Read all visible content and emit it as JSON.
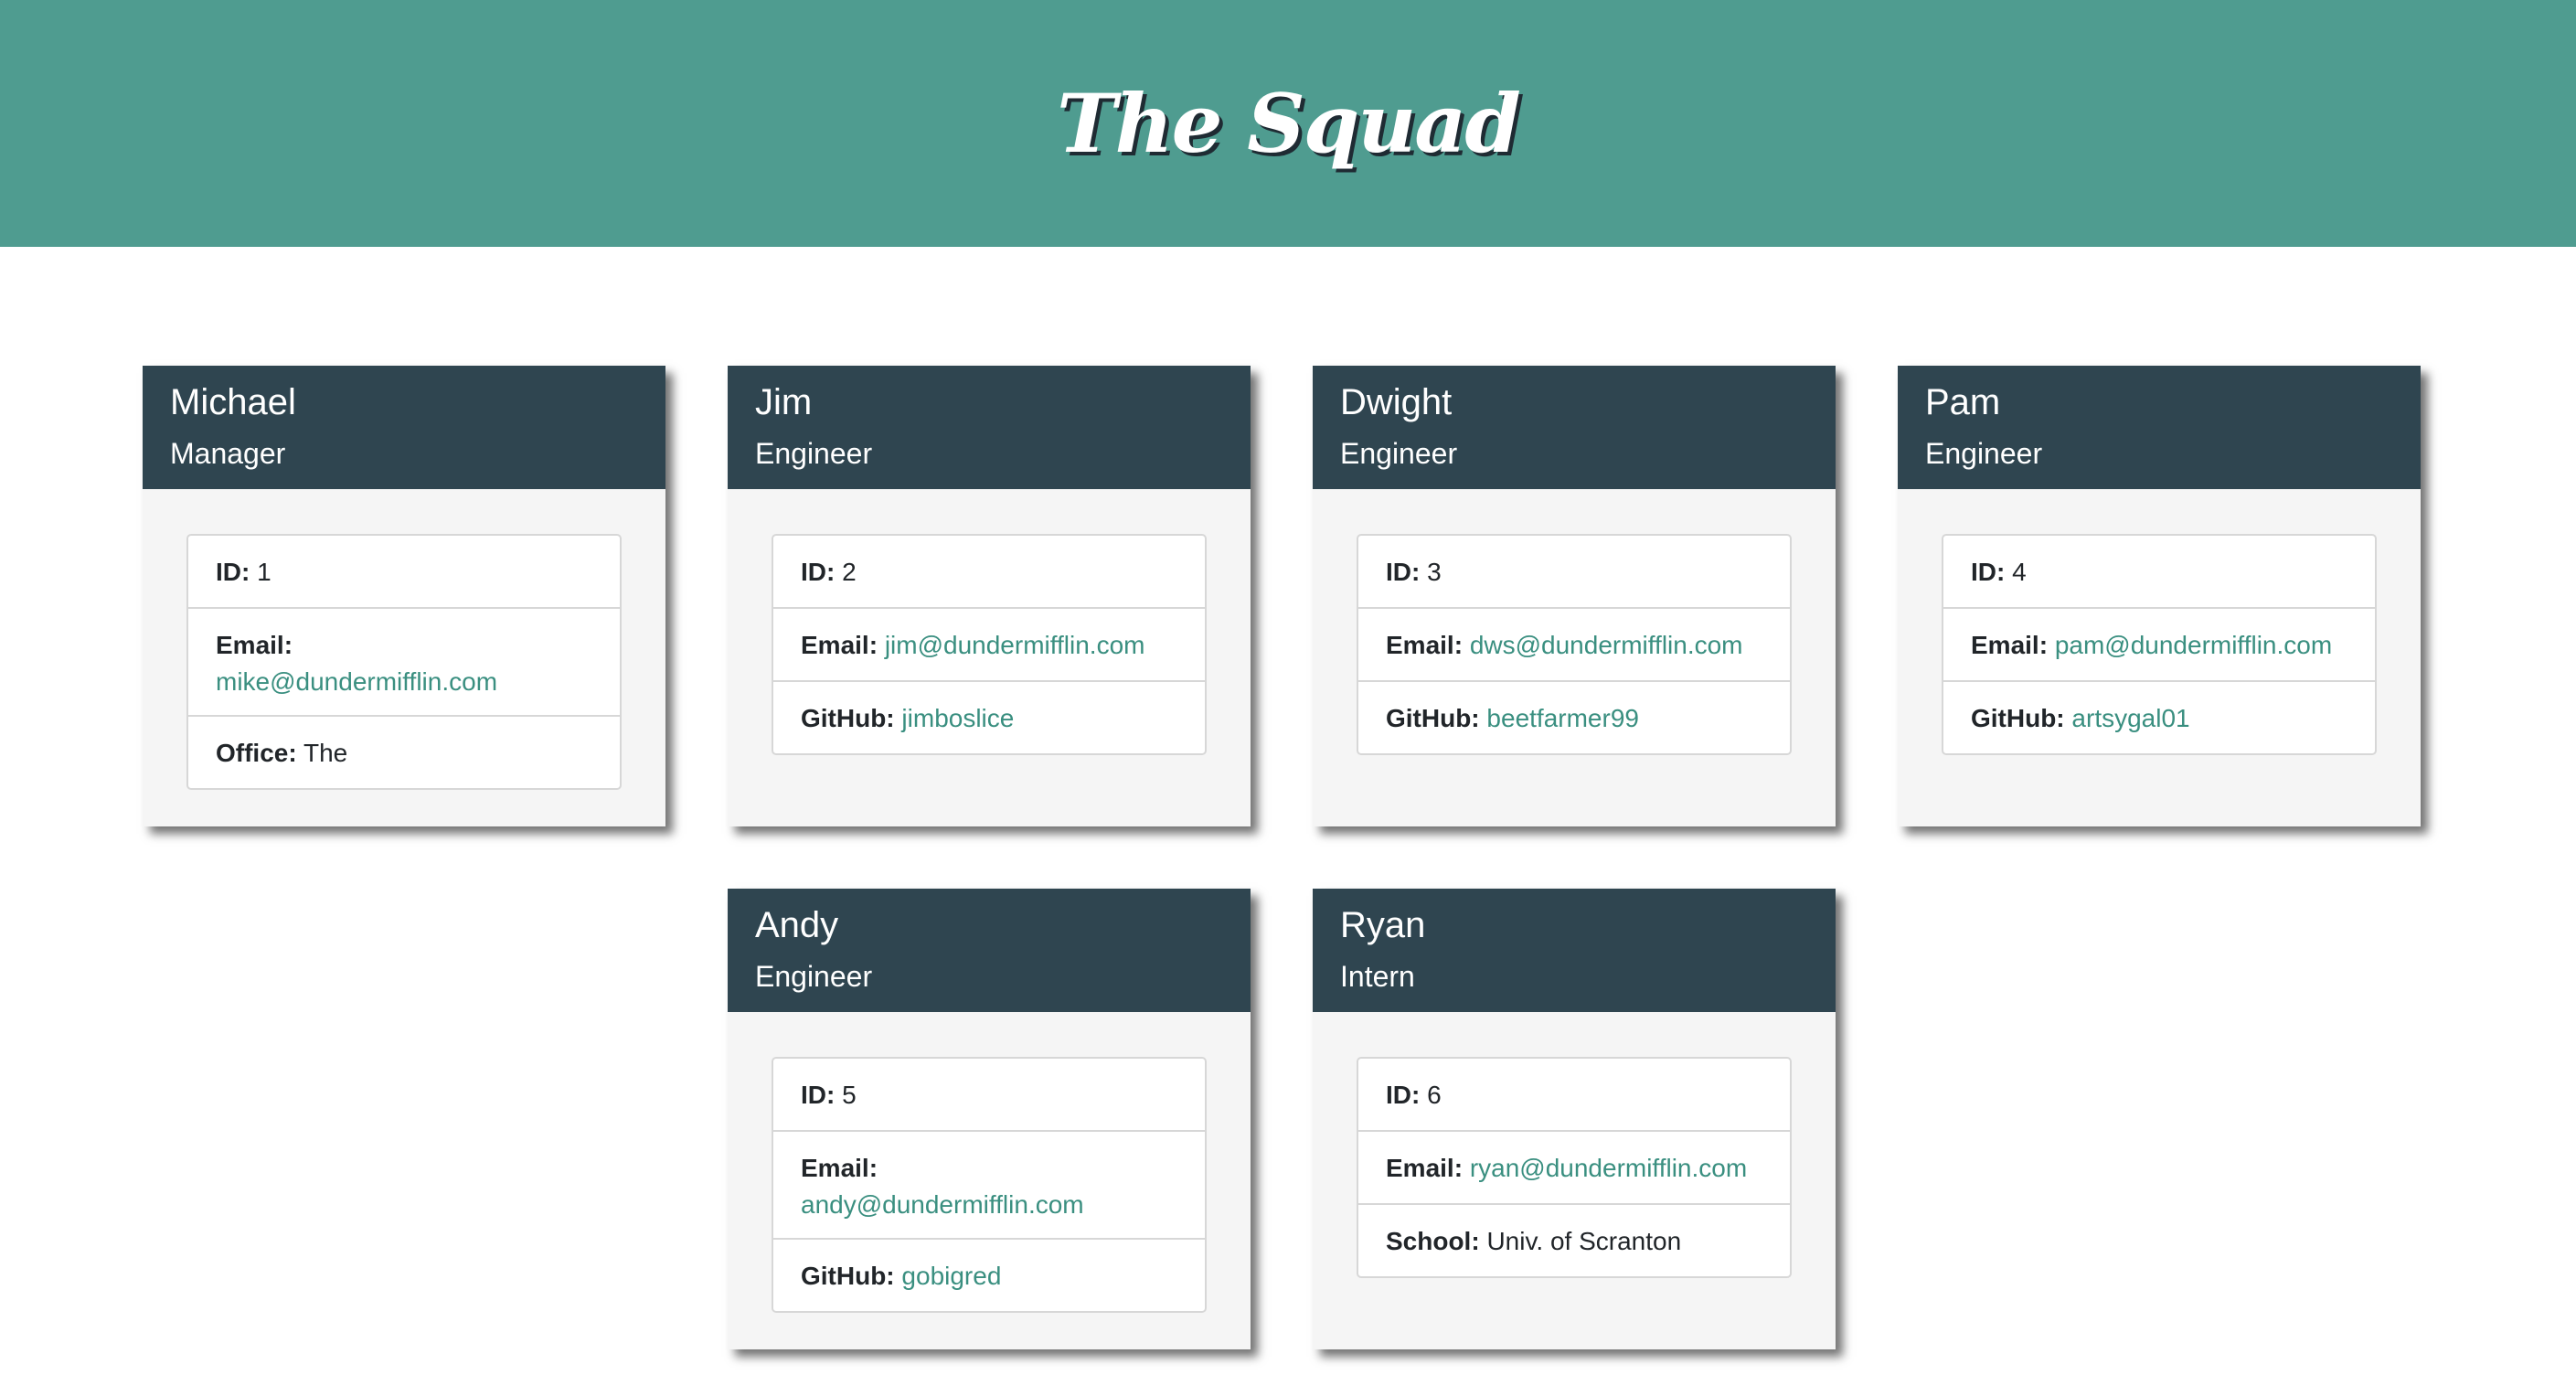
{
  "header": {
    "title": "The Squad"
  },
  "labels": {
    "id": "ID:",
    "email": "Email:",
    "github": "GitHub:",
    "office": "Office:",
    "school": "School:"
  },
  "team": [
    {
      "name": "Michael",
      "role": "Manager",
      "id": "1",
      "email": "mike@dundermifflin.com",
      "office": "The"
    },
    {
      "name": "Jim",
      "role": "Engineer",
      "id": "2",
      "email": "jim@dundermifflin.com",
      "github": "jimboslice"
    },
    {
      "name": "Dwight",
      "role": "Engineer",
      "id": "3",
      "email": "dws@dundermifflin.com",
      "github": "beetfarmer99"
    },
    {
      "name": "Pam",
      "role": "Engineer",
      "id": "4",
      "email": "pam@dundermifflin.com",
      "github": "artsygal01"
    },
    {
      "name": "Andy",
      "role": "Engineer",
      "id": "5",
      "email": "andy@dundermifflin.com",
      "github": "gobigred"
    },
    {
      "name": "Ryan",
      "role": "Intern",
      "id": "6",
      "email": "ryan@dundermifflin.com",
      "school": "Univ. of Scranton"
    }
  ],
  "colors": {
    "header_bg": "#4f9c90",
    "card_header_bg": "#2f4550",
    "link": "#3a8f80",
    "card_bg": "#f5f5f5"
  }
}
